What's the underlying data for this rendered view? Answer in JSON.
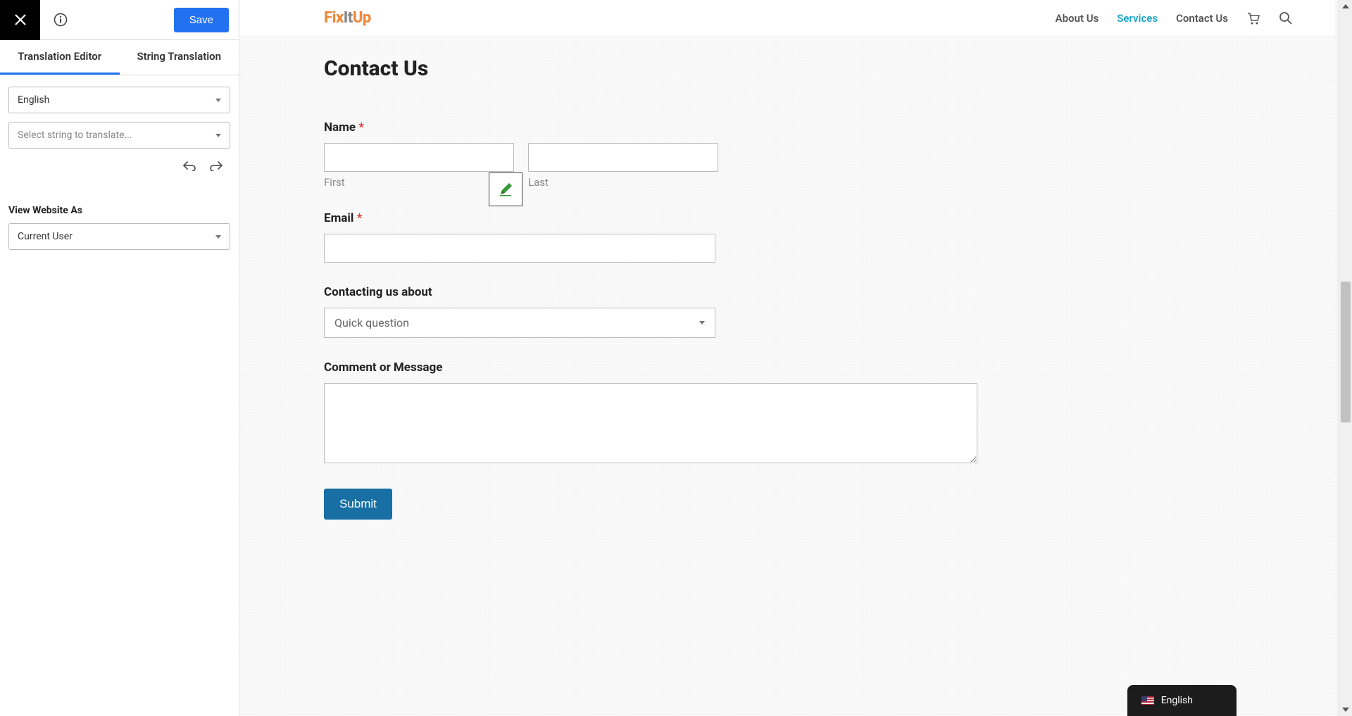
{
  "sidebar": {
    "save_label": "Save",
    "tabs": {
      "editor": "Translation Editor",
      "string": "String Translation"
    },
    "language_select": "English",
    "string_select_placeholder": "Select string to translate...",
    "view_as_label": "View Website As",
    "view_as_value": "Current User"
  },
  "site": {
    "logo_parts": [
      "Fix",
      "It",
      "Up"
    ],
    "nav": {
      "about": "About Us",
      "services": "Services",
      "contact": "Contact Us"
    }
  },
  "page": {
    "title": "Contact Us",
    "form": {
      "name_label": "Name",
      "first_sub": "First",
      "last_sub": "Last",
      "email_label": "Email",
      "about_label": "Contacting us about",
      "about_selected": "Quick question",
      "message_label": "Comment or Message",
      "submit_label": "Submit",
      "required_mark": "*"
    }
  },
  "lang_switch": {
    "label": "English"
  }
}
